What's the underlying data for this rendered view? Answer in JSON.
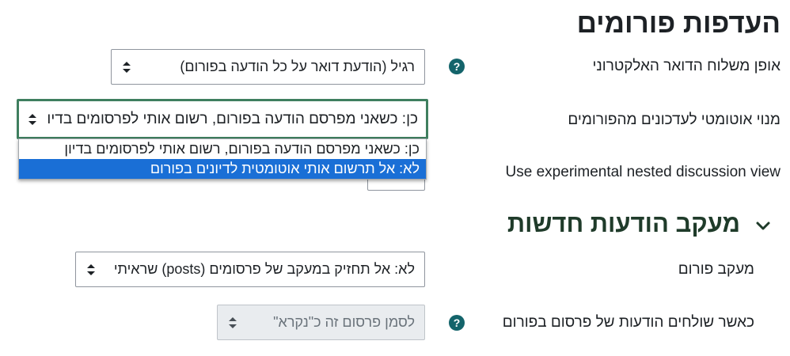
{
  "forum_prefs": {
    "heading": "העדפות פורומים",
    "mail_format": {
      "label": "אופן משלוח הדואר האלקטרוני",
      "value": "רגיל (הודעת דואר על כל הודעה בפורום)",
      "help_icon": "question-circle-icon"
    },
    "auto_subscribe": {
      "label": "מנוי אוטומטי לעדכונים מהפורומים",
      "value": "כן: כשאני מפרסם הודעה בפורום, רשום אותי לפרסומים בדיון",
      "options": [
        "כן: כשאני מפרסם הודעה בפורום, רשום אותי לפרסומים בדיון",
        "לא: אל תרשום אותי אוטומטית לדיונים בפורום"
      ],
      "highlighted_option": 1
    },
    "nested_view": {
      "label": "Use experimental nested discussion view"
    }
  },
  "tracking": {
    "heading": "מעקב הודעות חדשות",
    "chevron_icon": "chevron-down-icon",
    "forum_tracking": {
      "label": "מעקב פורום",
      "value": "לא: אל תחזיק במעקב של פרסומים (posts) שראיתי"
    },
    "mark_read": {
      "label": "כאשר שולחים הודעות של פרסום בפורום",
      "value": "לסמן פרסום זה כ\"נקרא\"",
      "help_icon": "question-circle-icon"
    }
  },
  "colors": {
    "help_icon": "#14646b",
    "focus_border": "#3f7f5f",
    "selected_option": "#1a6fd6",
    "section_heading": "#1f3b2a"
  }
}
